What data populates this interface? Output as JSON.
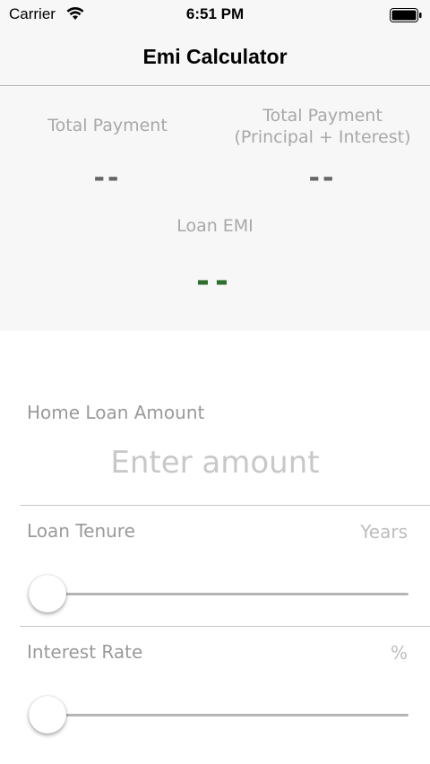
{
  "status_bar": {
    "carrier": "Carrier",
    "time": "6:51 PM",
    "wifi_icon": "wifi-icon",
    "battery_icon": "battery-icon"
  },
  "nav": {
    "title": "Emi Calculator"
  },
  "summary": {
    "total_payment_label": "Total Payment",
    "total_payment_value": "--",
    "total_principal_interest_label_line1": "Total Payment",
    "total_principal_interest_label_line2": "(Principal + Interest)",
    "total_principal_interest_value": "--",
    "loan_emi_label": "Loan EMI",
    "loan_emi_value": "--",
    "accent_color": "#2e6e2e"
  },
  "form": {
    "home_loan_amount_label": "Home Loan Amount",
    "amount_placeholder": "Enter amount",
    "amount_value": "",
    "loan_tenure_label": "Loan Tenure",
    "loan_tenure_unit": "Years",
    "loan_tenure_slider_value": 0,
    "interest_rate_label": "Interest Rate",
    "interest_rate_unit": "%",
    "interest_rate_slider_value": 0
  }
}
